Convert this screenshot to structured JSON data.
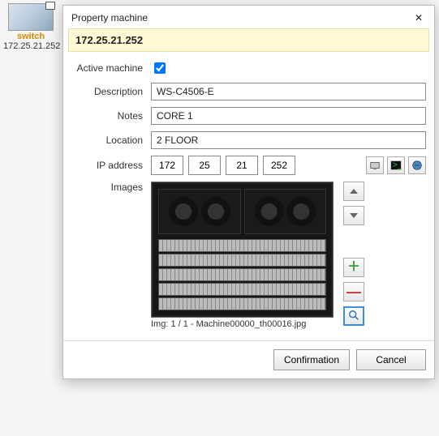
{
  "desktop": {
    "name": "switch",
    "ip": "172.25.21.252"
  },
  "dialog": {
    "title": "Property machine",
    "header_ip": "172.25.21.252",
    "labels": {
      "active": "Active machine",
      "description": "Description",
      "notes": "Notes",
      "location": "Location",
      "ip": "IP address",
      "images": "Images"
    },
    "values": {
      "active": true,
      "description": "WS-C4506-E",
      "notes": "CORE 1",
      "location": "2 FLOOR",
      "ip": [
        "172",
        "25",
        "21",
        "252"
      ]
    },
    "image_caption": "Img: 1 / 1 - Machine00000_th00016.jpg",
    "buttons": {
      "confirm": "Confirmation",
      "cancel": "Cancel"
    }
  }
}
